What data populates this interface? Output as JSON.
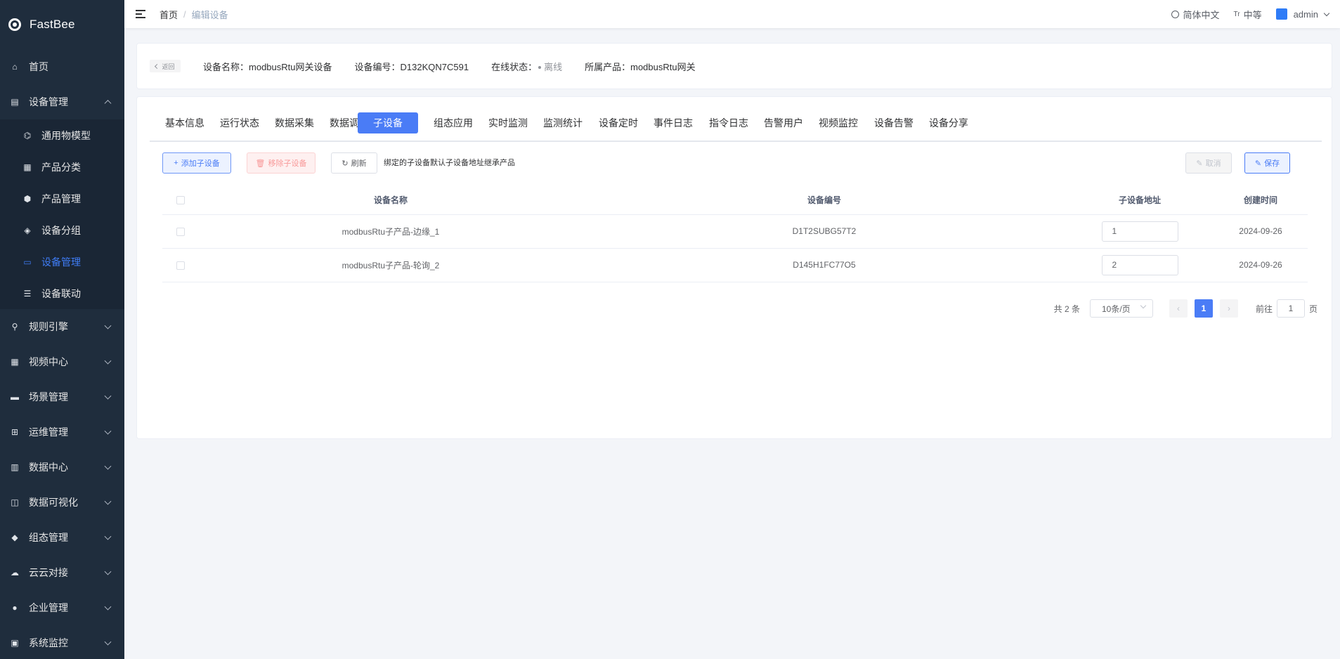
{
  "brand": {
    "name": "FastBee"
  },
  "sidebar": {
    "items": [
      {
        "label": "首页",
        "icon": "home-icon",
        "glyph": "⌂"
      },
      {
        "label": "设备管理",
        "icon": "device-list-icon",
        "glyph": "▤",
        "expanded": true,
        "children": [
          {
            "label": "通用物模型",
            "icon": "model-icon",
            "glyph": "⌬"
          },
          {
            "label": "产品分类",
            "icon": "category-icon",
            "glyph": "▦"
          },
          {
            "label": "产品管理",
            "icon": "product-icon",
            "glyph": "⬢"
          },
          {
            "label": "设备分组",
            "icon": "group-icon",
            "glyph": "◈"
          },
          {
            "label": "设备管理",
            "icon": "device-icon",
            "glyph": "▭",
            "active": true
          },
          {
            "label": "设备联动",
            "icon": "linkage-icon",
            "glyph": "☰"
          }
        ]
      },
      {
        "label": "规则引擎",
        "icon": "rule-icon",
        "glyph": "⚲"
      },
      {
        "label": "视频中心",
        "icon": "video-icon",
        "glyph": "▦"
      },
      {
        "label": "场景管理",
        "icon": "scene-icon",
        "glyph": "▬"
      },
      {
        "label": "运维管理",
        "icon": "ops-icon",
        "glyph": "⊞"
      },
      {
        "label": "数据中心",
        "icon": "data-icon",
        "glyph": "▥"
      },
      {
        "label": "数据可视化",
        "icon": "visual-icon",
        "glyph": "◫"
      },
      {
        "label": "组态管理",
        "icon": "config-icon",
        "glyph": "◆"
      },
      {
        "label": "云云对接",
        "icon": "cloud-icon",
        "glyph": "☁"
      },
      {
        "label": "企业管理",
        "icon": "enterprise-icon",
        "glyph": "●"
      },
      {
        "label": "系统监控",
        "icon": "monitor-icon",
        "glyph": "▣"
      }
    ]
  },
  "topbar": {
    "breadcrumb": {
      "home": "首页",
      "sep": "/",
      "current": "编辑设备"
    },
    "language": "简体中文",
    "size_label": "中等",
    "size_icon_text": "Tr",
    "user": "admin"
  },
  "device": {
    "back": "返回",
    "name_label": "设备名称：",
    "name": "modbusRtu网关设备",
    "serial_label": "设备编号：",
    "serial": "D132KQN7C591",
    "status_label": "在线状态：",
    "status": "离线",
    "product_label": "所属产品：",
    "product": "modbusRtu网关"
  },
  "tabs": [
    "基本信息",
    "运行状态",
    "数据采集",
    "数据调试",
    "子设备",
    "组态应用",
    "实时监测",
    "监测统计",
    "设备定时",
    "事件日志",
    "指令日志",
    "告警用户",
    "视频监控",
    "设备告警",
    "设备分享"
  ],
  "active_tab": 4,
  "toolbar": {
    "add": "添加子设备",
    "remove": "移除子设备",
    "refresh": "刷新",
    "hint": "绑定的子设备默认子设备地址继承产品",
    "cancel": "取消",
    "save": "保存"
  },
  "table": {
    "headers": [
      "设备名称",
      "设备编号",
      "子设备地址",
      "创建时间"
    ],
    "rows": [
      {
        "name": "modbusRtu子产品-边缘_1",
        "serial": "D1T2SUBG57T2",
        "address": "1",
        "created": "2024-09-26"
      },
      {
        "name": "modbusRtu子产品-轮询_2",
        "serial": "D145H1FC77O5",
        "address": "2",
        "created": "2024-09-26"
      }
    ]
  },
  "pagination": {
    "total": "共 2 条",
    "page_size": "10条/页",
    "prev": "‹",
    "current": "1",
    "next": "›",
    "goto_label": "前往",
    "goto_value": "1",
    "page_unit": "页"
  },
  "colors": {
    "sidebar_bg": "#1f2d3d",
    "accent": "#4a7cf6",
    "danger_light": "#f89898"
  }
}
